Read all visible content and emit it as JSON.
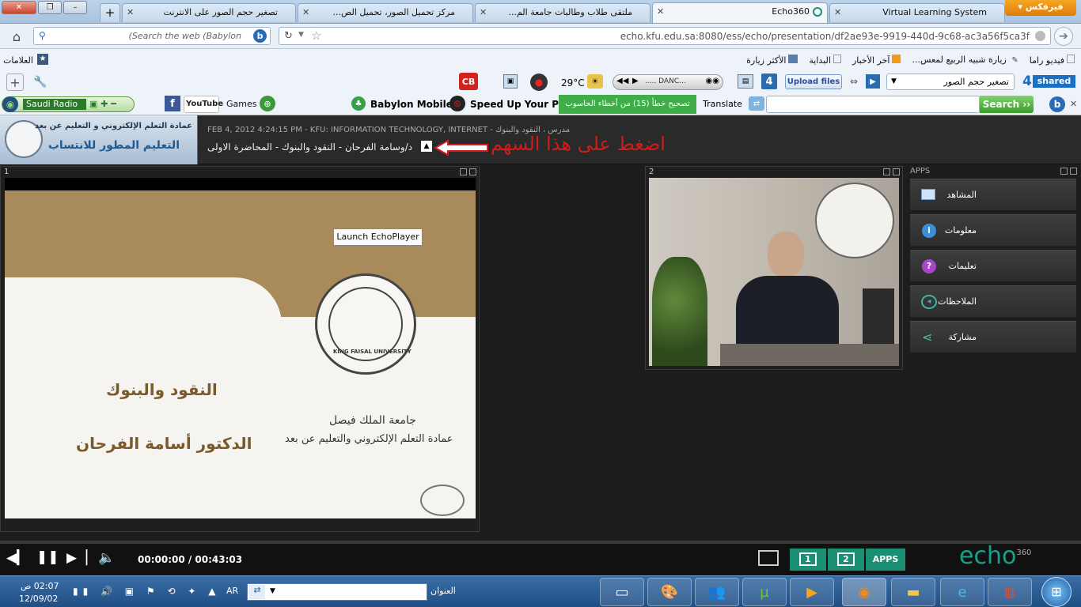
{
  "browser": {
    "tabs": [
      {
        "label": "تصغير حجم الصور على الانترنت"
      },
      {
        "label": "مركز تحميل الصور، تحميل الص..."
      },
      {
        "label": "ملتقى طلاب وطالبات جامعة الم..."
      },
      {
        "label": "Echo360"
      },
      {
        "label": "Virtual Learning System"
      }
    ],
    "new_tab": "+",
    "firefox_button": "فيرفكس",
    "search_placeholder": "(Search the web (Babylon",
    "url": "echo.kfu.edu.sa:8080/ess/echo/presentation/df2ae93e-9919-440d-9c68-ac3a56f5ca3f"
  },
  "bookmarks": {
    "left_label": "العلامات",
    "items": [
      {
        "label": "الأكثر زيارة"
      },
      {
        "label": "البداية"
      },
      {
        "label": "آخر الأخبار"
      },
      {
        "label": "زيارة شبيه الربيع لمعس..."
      },
      {
        "label": "فيديو راما"
      }
    ]
  },
  "toolbar1": {
    "temperature": "29°C",
    "media_title": "..... DANC...",
    "upload_files": "Upload files",
    "dropdown_value": "تصغير حجم الصور",
    "shared": "shared"
  },
  "toolbar2": {
    "radio": "Saudi Radio",
    "youtube": "YouTube",
    "games": "Games",
    "babylon_mobile": "Babylon Mobile",
    "speed_up": "Speed Up Your PC",
    "fix_errors": "تصحيح خطأ (15) من أخطاء الحاسوب",
    "translate": "Translate",
    "search_button": "Search ››"
  },
  "echo": {
    "logo_line1": "عمادة التعلم الإلكتروني و التعليم عن بعد",
    "logo_line2": "التعليم المطور للانتساب",
    "meta_line": "FEB 4, 2012 4:24:15 PM - KFU: INFORMATION TECHNOLOGY, INTERNET - مدرس ، النقود والبنوك",
    "title_line": "د/وسامة الفرحان - النقود والبنوك - المحاضرة الاولى",
    "annotation": "اضغط على هذا السهم",
    "panel1_number": "1",
    "panel2_number": "2",
    "apps_label": "APPS",
    "launch_player": "Launch EchoPlayer",
    "slide_course": "النقود والبنوك",
    "slide_doctor": "الدكتور أسامة الفرحان",
    "slide_university": "جامعة الملك فيصل",
    "slide_deanship": "عمادة التعلم الإلكتروني والتعليم عن بعد",
    "seal_text": "KING FAISAL UNIVERSITY",
    "apps": [
      {
        "label": "المشاهد",
        "icon": "list-icon"
      },
      {
        "label": "معلومات",
        "icon": "info-icon"
      },
      {
        "label": "تعليمات",
        "icon": "help-icon"
      },
      {
        "label": "الملاحظات",
        "icon": "notes-icon"
      },
      {
        "label": "مشاركة",
        "icon": "share-icon"
      }
    ],
    "time": "00:00:00 / 00:43:03",
    "view1": "1",
    "view2": "2",
    "apps_button": "APPS",
    "brand": "echo",
    "brand_sup": "360"
  },
  "taskbar": {
    "clock_time": "02:07 ص",
    "clock_date": "12/09/02",
    "lang": "AR",
    "address_label": "العنوان"
  },
  "colors": {
    "accent_red": "#d21b1b",
    "green": "#1a8f74",
    "fix_green": "#3fae49"
  }
}
